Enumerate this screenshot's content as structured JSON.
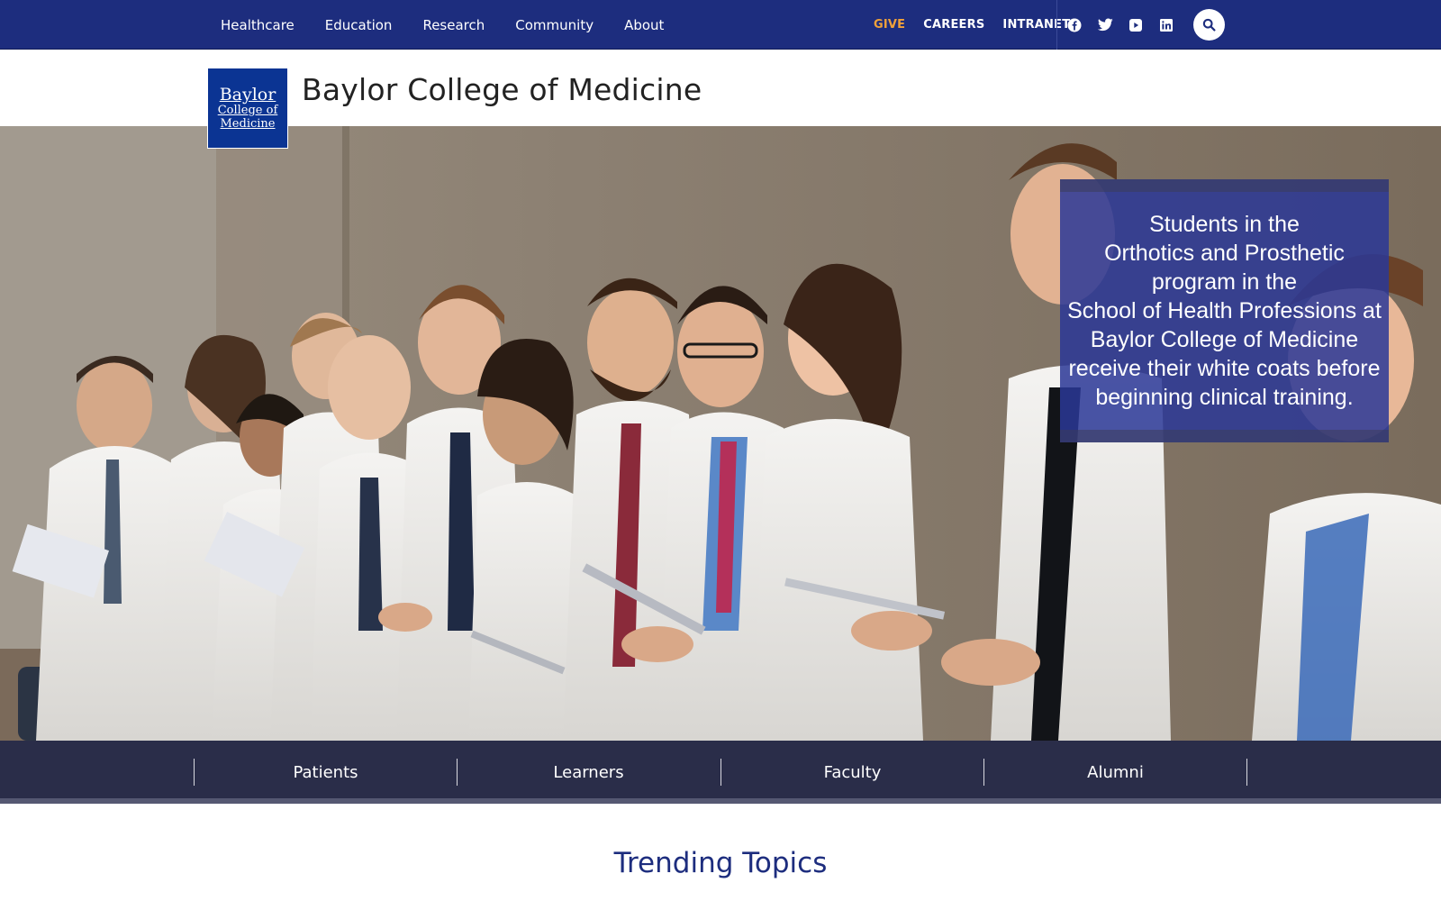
{
  "topbar": {
    "primary_nav": [
      "Healthcare",
      "Education",
      "Research",
      "Community",
      "About"
    ],
    "utility_nav": {
      "give": "GIVE",
      "careers": "CAREERS",
      "intranet": "INTRANET"
    },
    "social_icons": [
      "facebook-icon",
      "twitter-icon",
      "youtube-icon",
      "linkedin-icon"
    ],
    "search_icon": "search-icon",
    "colors": {
      "background": "#1d2d7e",
      "give": "#f0a13a"
    }
  },
  "brand": {
    "logo_line1": "Baylor",
    "logo_line2": "College of",
    "logo_line3": "Medicine",
    "site_title": "Baylor College of Medicine",
    "logo_color": "#0b3493"
  },
  "hero": {
    "caption": "Students in the\nOrthotics and Prosthetic\nprogram in the\nSchool of Health Professions at\nBaylor College of Medicine\nreceive their white coats before\nbeginning clinical training."
  },
  "audience_nav": [
    "Patients",
    "Learners",
    "Faculty",
    "Alumni"
  ],
  "trending": {
    "heading": "Trending Topics"
  }
}
